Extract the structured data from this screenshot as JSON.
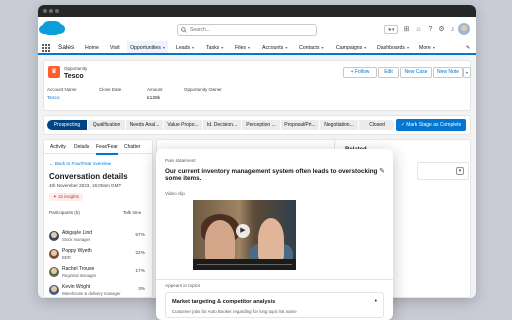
{
  "app": {
    "name": "Sales"
  },
  "search": {
    "placeholder": "Search..."
  },
  "nav": {
    "items": [
      {
        "label": "Home",
        "chevron": false
      },
      {
        "label": "Visit",
        "chevron": false
      },
      {
        "label": "Opportunities",
        "chevron": true,
        "active": true
      },
      {
        "label": "Leads",
        "chevron": true
      },
      {
        "label": "Tasks",
        "chevron": true
      },
      {
        "label": "Files",
        "chevron": true
      },
      {
        "label": "Accounts",
        "chevron": true
      },
      {
        "label": "Contacts",
        "chevron": true
      },
      {
        "label": "Campaigns",
        "chevron": true
      },
      {
        "label": "Dashboards",
        "chevron": true
      },
      {
        "label": "More",
        "chevron": true
      }
    ]
  },
  "record": {
    "object_type": "Opportunity",
    "name": "Tesco",
    "actions": [
      "+ Follow",
      "Edit",
      "New Case",
      "New Note"
    ],
    "fields": [
      {
        "label": "Account Name",
        "value": "Tesco",
        "link": true
      },
      {
        "label": "Close Date",
        "value": ""
      },
      {
        "label": "Amount",
        "value": "£128k"
      },
      {
        "label": "Opportunity Owner",
        "value": ""
      }
    ]
  },
  "path": {
    "stages": [
      "Prospecting",
      "Qualification",
      "Needs Anal...",
      "Value Propo...",
      "Id. Decision...",
      "Perception ...",
      "Proposal/Pri...",
      "Negotiation...",
      "Closed"
    ],
    "current_index": 0,
    "mark_button": "✓ Mark Stage as Complete"
  },
  "left": {
    "tabs": [
      "Activity",
      "Details",
      "Fear/Fear",
      "Chatter"
    ],
    "selected_tab": 2,
    "back_link": "Back to Four/Fear overview",
    "title": "Conversation details",
    "date": "4th November 2023, 15:00am GMT",
    "insights": "15 insights",
    "participants_header": "Participants (5)",
    "talk_header": "Talk time",
    "participants": [
      {
        "name": "Abigayle Lind",
        "role": "Stock manager",
        "talk": "57%",
        "color": "#3a4a5c"
      },
      {
        "name": "Poppy Wyeth",
        "role": "BDR",
        "talk": "22%",
        "color": "#7a4e3a"
      },
      {
        "name": "Rachel Trouse",
        "role": "Regional manager",
        "talk": "17%",
        "color": "#5a6b4a"
      },
      {
        "name": "Kevin Wright",
        "role": "Warehouse & delivery manager",
        "talk": "3%",
        "color": "#4a5a7a"
      }
    ]
  },
  "related": {
    "title": "Related"
  },
  "popup": {
    "pain_label": "Pain statement",
    "pain_text": "Our current inventory management system often leads to overstocking some items.",
    "video_label": "Video clip",
    "topics_label": "Appears in topics",
    "topic_title": "Market targeting & competitor analysis",
    "topic_sub": "Customer jobs for Auto Booker regarding for long topic list name"
  }
}
